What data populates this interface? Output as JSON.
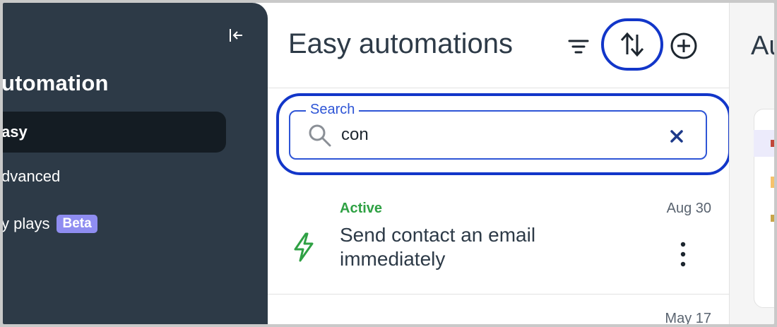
{
  "sidebar": {
    "title": "utomation",
    "collapse_icon": "collapse-sidebar-icon",
    "items": [
      {
        "label": "asy",
        "active": true
      },
      {
        "label": "dvanced",
        "active": false
      },
      {
        "label": "y plays",
        "active": false,
        "badge": "Beta"
      }
    ]
  },
  "panel": {
    "title": "Easy automations",
    "toolbar": {
      "filter_icon": "filter-icon",
      "sort_icon": "sort-icon",
      "add_icon": "add-circle-icon"
    },
    "search": {
      "label": "Search",
      "value": "con",
      "icon": "search-icon",
      "clear_icon": "clear-icon"
    },
    "list": [
      {
        "status": "Active",
        "title": "Send contact an email immediately",
        "date": "Aug 30",
        "icon": "lightning-bolt-icon"
      }
    ],
    "next_date": "May 17"
  },
  "right_panel": {
    "title": "Au"
  },
  "colors": {
    "sidebar_bg": "#2d3a47",
    "active_item_bg": "#141c23",
    "highlight_ring": "#1236c9",
    "active_status": "#2fa144",
    "badge_bg": "#8f8df1"
  }
}
